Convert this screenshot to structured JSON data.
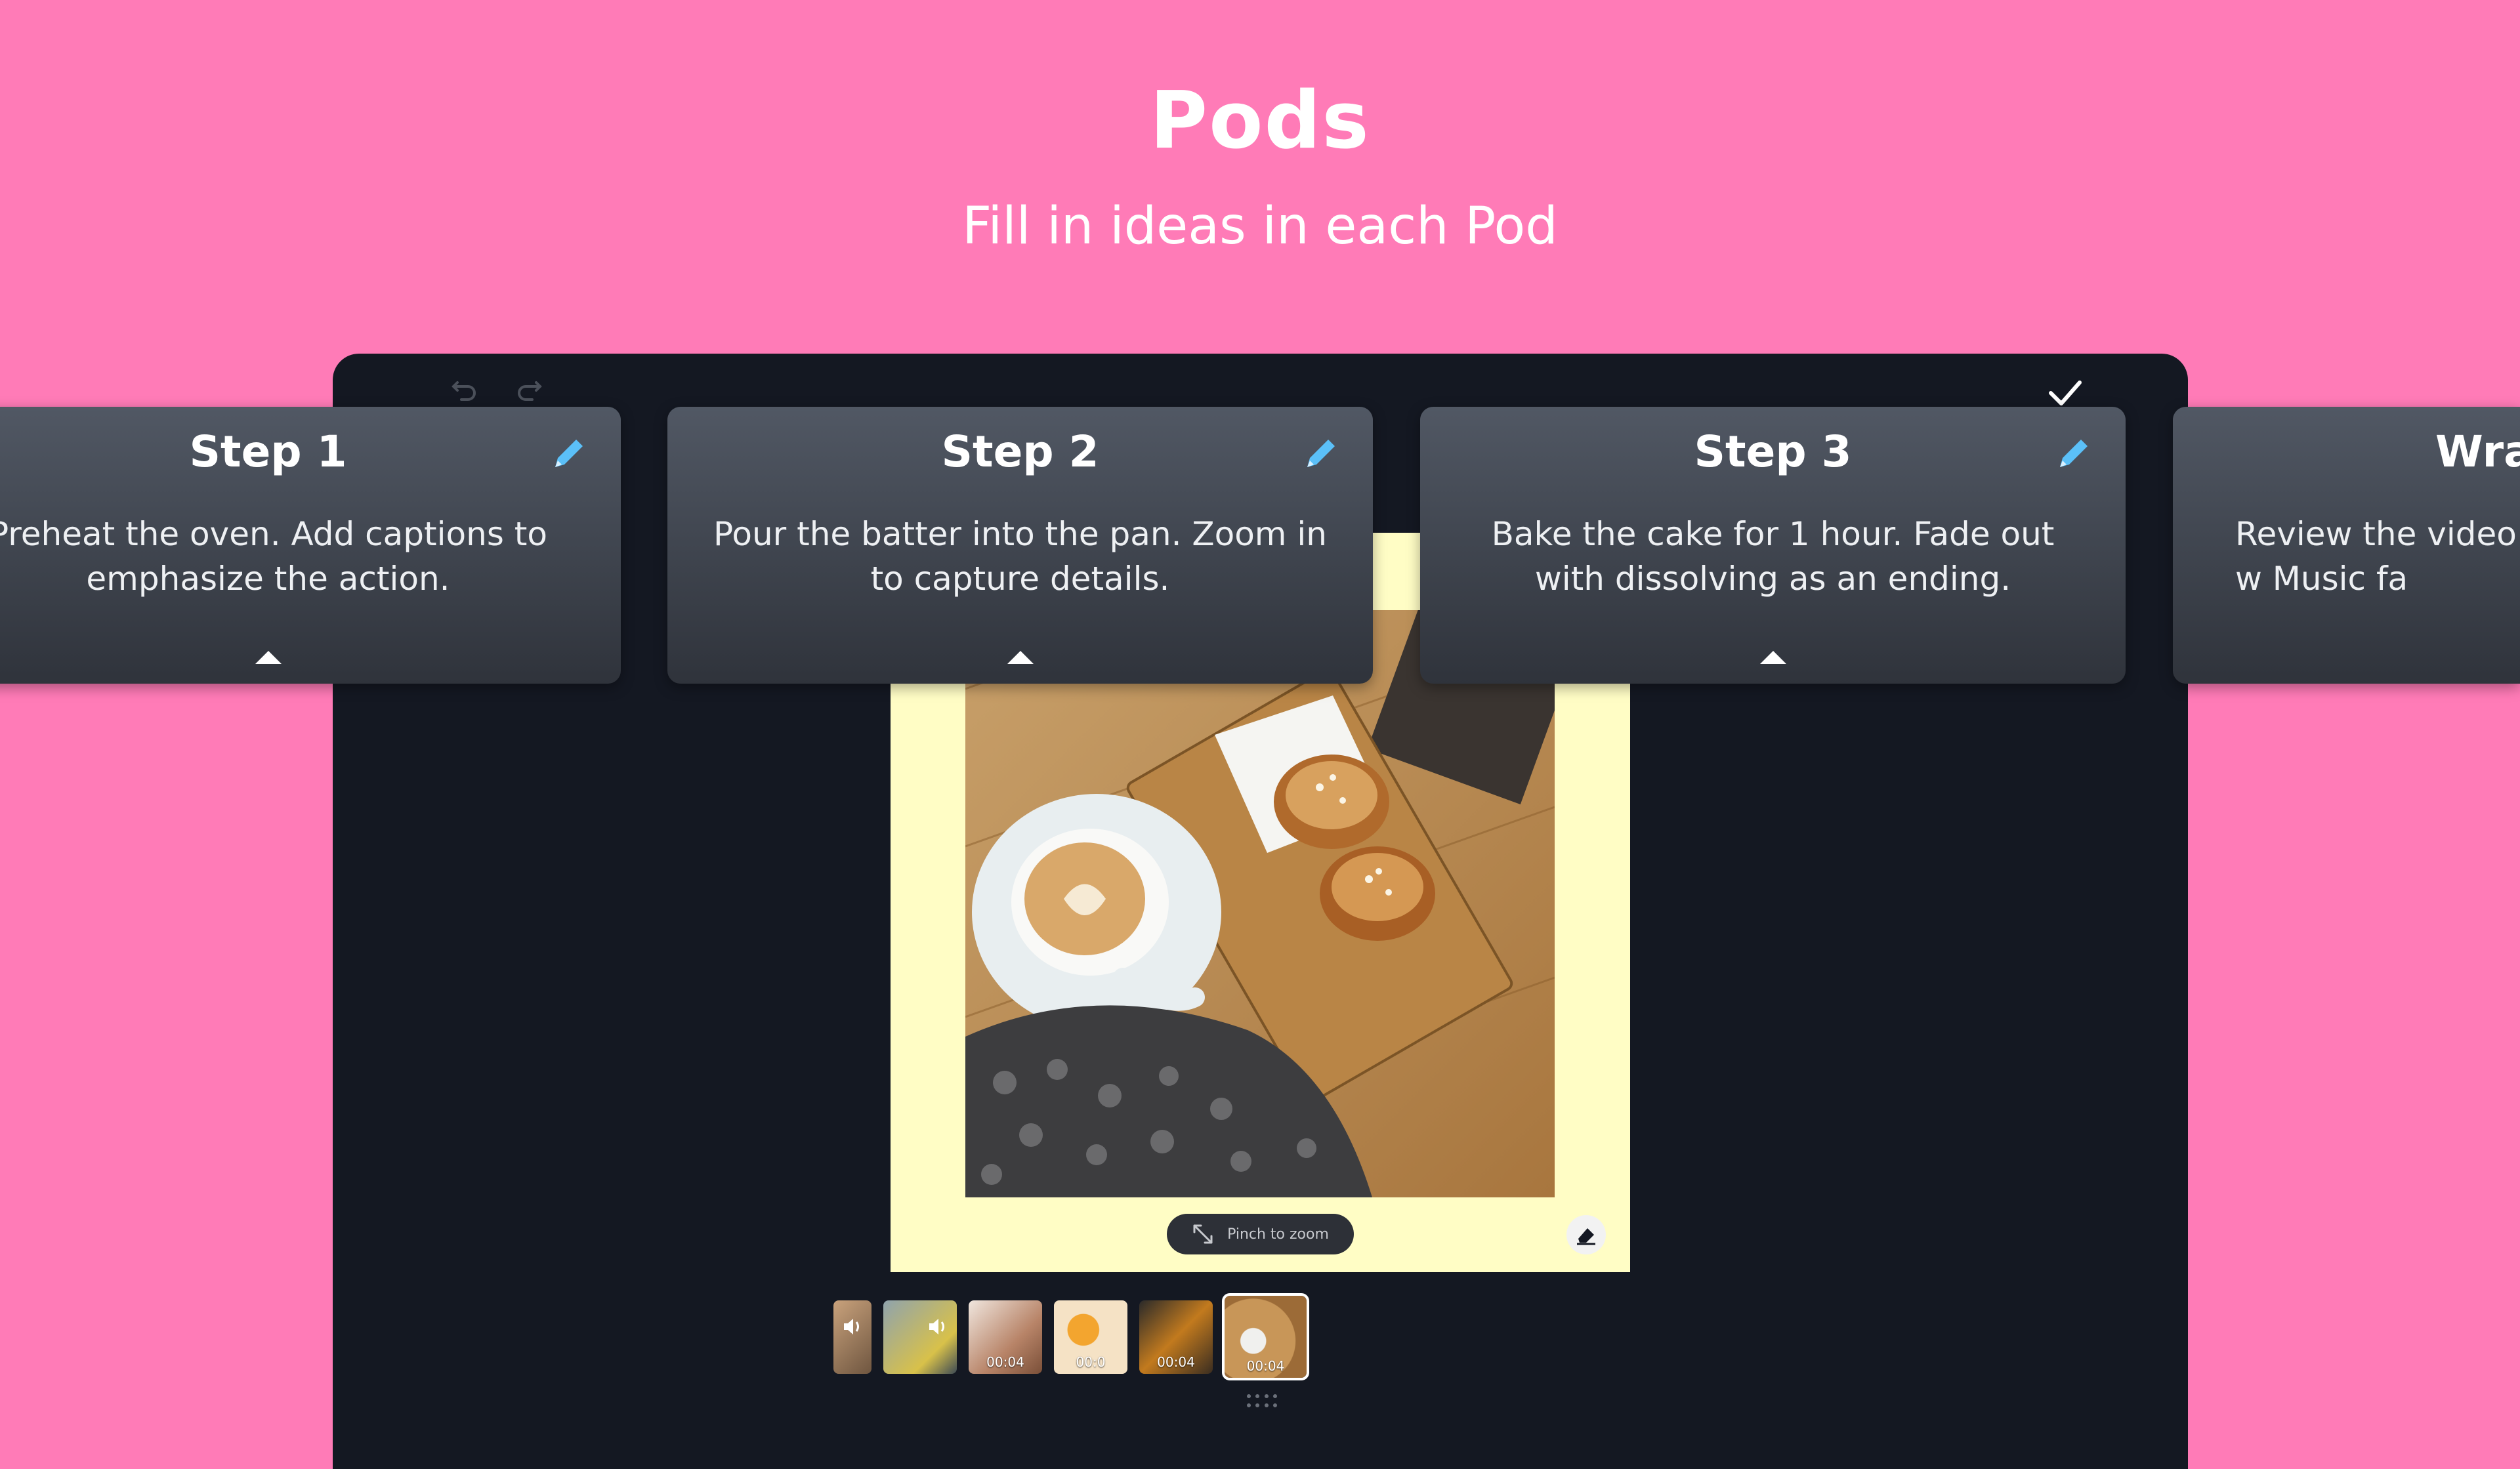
{
  "header": {
    "title": "Pods",
    "subtitle": "Fill in ideas in each Pod"
  },
  "toolbar": {
    "undo_icon": "undo-icon",
    "redo_icon": "redo-icon",
    "done_icon": "checkmark-icon"
  },
  "pods": [
    {
      "title": "Step 1",
      "body": "Preheat the oven. Add captions to emphasize the action."
    },
    {
      "title": "Step 2",
      "body": "Pour the batter into the pan. Zoom in to capture details."
    },
    {
      "title": "Step 3",
      "body": "Bake the cake for 1 hour. Fade out with dissolving as an ending."
    },
    {
      "title": "Wra",
      "body": "Review the video w Music fa"
    }
  ],
  "canvas": {
    "pinch_label": "Pinch to zoom"
  },
  "timeline": {
    "thumbs": [
      {
        "duration": "",
        "has_audio": true
      },
      {
        "duration": "",
        "has_audio": true
      },
      {
        "duration": "00:04"
      },
      {
        "duration": "00:0"
      },
      {
        "duration": "00:04"
      },
      {
        "duration": "00:04"
      }
    ]
  },
  "colors": {
    "background": "#FF7BB7",
    "device": "#141822",
    "canvas": "#FFFDC5",
    "pencil_accent": "#5BC0F8"
  }
}
